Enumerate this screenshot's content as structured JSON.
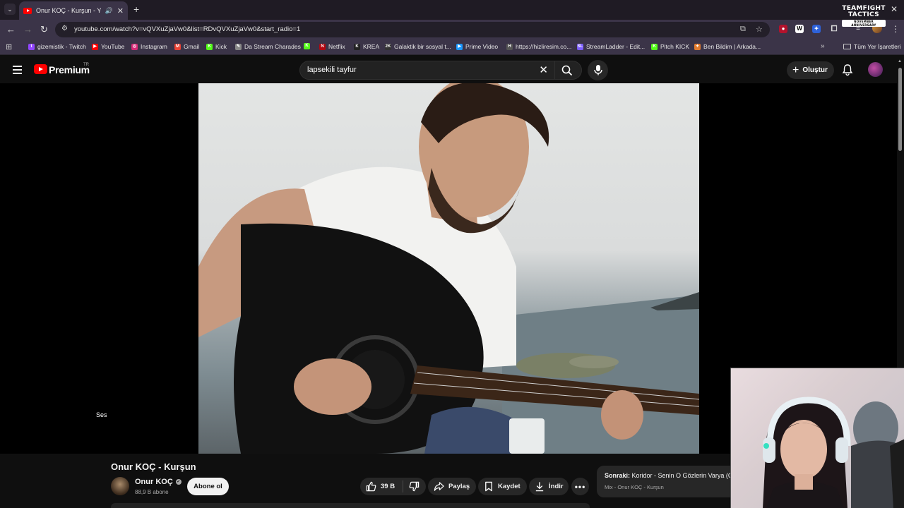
{
  "browser": {
    "tab_title": "Onur KOÇ - Kurşun - YouTube",
    "new_tab_symbol": "+",
    "close_symbol": "✕",
    "url": "youtube.com/watch?v=vQVXuZjaVw0&list=RDvQVXuZjaVw0&start_radio=1",
    "overlay_logo_line1": "TEAMFIGHT",
    "overlay_logo_line2": "TACTICS",
    "overlay_logo_sub": "NOVEMBER ANNIVERSARY",
    "bookmarks": [
      {
        "label": "gizemistik - Twitch",
        "color": "#9146ff",
        "glyph": "t"
      },
      {
        "label": "YouTube",
        "color": "#ff0000",
        "glyph": "▶"
      },
      {
        "label": "Instagram",
        "color": "#d62976",
        "glyph": "◎"
      },
      {
        "label": "Gmail",
        "color": "#ea4335",
        "glyph": "M"
      },
      {
        "label": "Kick",
        "color": "#53fc18",
        "glyph": "K"
      },
      {
        "label": "Da Stream Charades",
        "color": "#888888",
        "glyph": "✎"
      },
      {
        "label": "",
        "color": "#53fc18",
        "glyph": "K"
      },
      {
        "label": "Netflix",
        "color": "#b20710",
        "glyph": "N"
      },
      {
        "label": "KREA",
        "color": "#222222",
        "glyph": "K"
      },
      {
        "label": "Galaktik bir sosyal t...",
        "color": "#333333",
        "glyph": "2K"
      },
      {
        "label": "Prime Video",
        "color": "#1a98ff",
        "glyph": "▶"
      },
      {
        "label": "https://hizliresim.co...",
        "color": "#555555",
        "glyph": "H"
      },
      {
        "label": "StreamLadder - Edit...",
        "color": "#7b5cff",
        "glyph": "SL"
      },
      {
        "label": "Pitch KICK",
        "color": "#53fc18",
        "glyph": "K"
      },
      {
        "label": "Ben Bildim | Arkada...",
        "color": "#e07a2e",
        "glyph": "✦"
      }
    ],
    "all_bookmarks_label": "Tüm Yer İşaretleri"
  },
  "youtube": {
    "brand": "Premium",
    "country": "TR",
    "search_query": "lapsekili tayfur",
    "create_label": "Oluştur",
    "volume_tooltip": "Ses",
    "video_title": "Onur KOÇ - Kurşun",
    "channel_name": "Onur KOÇ",
    "subscribers": "88,9 B abone",
    "subscribe_label": "Abone ol",
    "likes": "39 B",
    "share_label": "Paylaş",
    "save_label": "Kaydet",
    "download_label": "İndir",
    "next": {
      "prefix": "Sonraki:",
      "title": "Koridor - Senin O Gözlerin Varya (O",
      "subtitle": "Mix - Onur KOÇ - Kurşun"
    }
  },
  "colors": {
    "youtube_red": "#ff0000",
    "page_bg": "#0f0f0f",
    "chrome_bg": "#3b3448"
  }
}
